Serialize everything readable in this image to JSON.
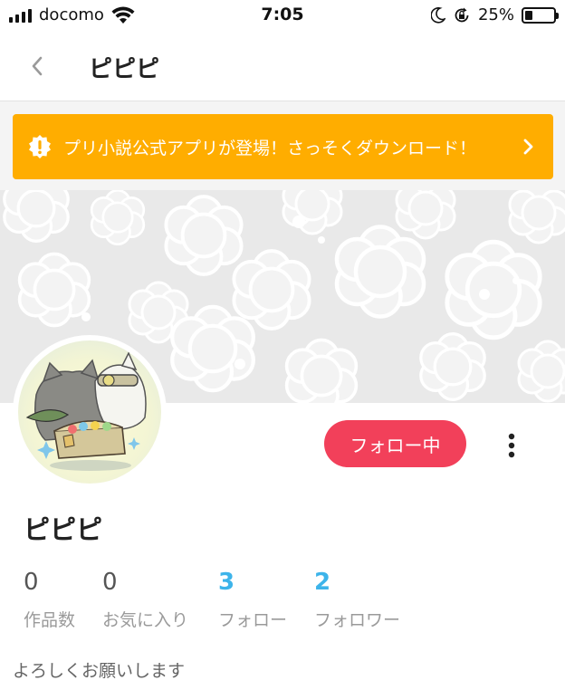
{
  "status_bar": {
    "carrier": "docomo",
    "time": "7:05",
    "battery_percent": "25%",
    "battery_level": 0.25,
    "icons": [
      "signal-icon",
      "wifi-icon",
      "moon-icon",
      "rotation-lock-icon",
      "battery-icon"
    ]
  },
  "nav": {
    "title": "ピピピ",
    "back_icon": "chevron-left-icon"
  },
  "banner": {
    "text": "プリ小説公式アプリが登場！さっそくダウンロード！",
    "icon": "alert-icon",
    "arrow_icon": "chevron-right-icon",
    "color": "#ffad00"
  },
  "profile": {
    "name": "ピピピ",
    "follow_label": "フォロー中",
    "follow_color": "#f2405a",
    "more_icon": "more-vertical-icon",
    "bio": "よろしくお願いします"
  },
  "stats": [
    {
      "value": "0",
      "label": "作品数"
    },
    {
      "value": "0",
      "label": "お気に入り"
    },
    {
      "value": "3",
      "label": "フォロー"
    },
    {
      "value": "2",
      "label": "フォロワー"
    }
  ],
  "accent_blue": "#3db4ea"
}
